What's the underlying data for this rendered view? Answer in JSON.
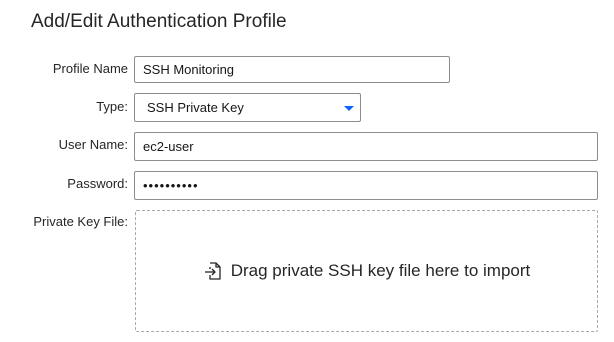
{
  "dialog": {
    "title": "Add/Edit Authentication Profile"
  },
  "form": {
    "profile_name": {
      "label": "Profile Name",
      "value": "SSH Monitoring"
    },
    "type": {
      "label": "Type:",
      "value": "SSH Private Key"
    },
    "user_name": {
      "label": "User Name:",
      "value": "ec2-user"
    },
    "password": {
      "label": "Password:",
      "value": "••••••••••"
    },
    "private_key_file": {
      "label": "Private Key File:",
      "dropzone_text": "Drag private SSH key file here to import",
      "icon": "file-import-icon"
    }
  },
  "colors": {
    "accent": "#0f62fe",
    "border": "#8d8d8d",
    "dashed_border": "#a8a8a8"
  }
}
